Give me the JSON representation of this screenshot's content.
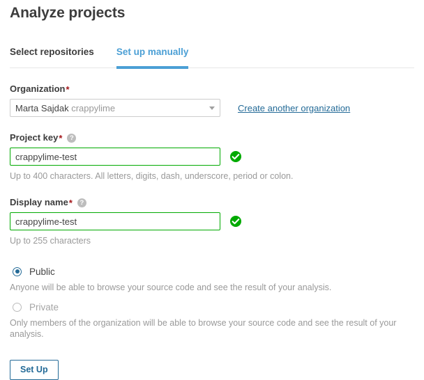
{
  "page": {
    "title": "Analyze projects"
  },
  "tabs": [
    {
      "label": "Select repositories",
      "active": false
    },
    {
      "label": "Set up manually",
      "active": true
    }
  ],
  "organization": {
    "label": "Organization",
    "required_marker": "*",
    "selected_name": "Marta Sajdak",
    "selected_key": "crappylime",
    "dropdown_icon": "chevron-down-icon",
    "create_link": "Create another organization"
  },
  "project_key": {
    "label": "Project key",
    "required_marker": "*",
    "help_icon": "help-icon",
    "value": "crappylime-test",
    "placeholder": "",
    "valid_icon": "check-circle-icon",
    "hint": "Up to 400 characters. All letters, digits, dash, underscore, period or colon."
  },
  "display_name": {
    "label": "Display name",
    "required_marker": "*",
    "help_icon": "help-icon",
    "value": "crappylime-test",
    "placeholder": "",
    "valid_icon": "check-circle-icon",
    "hint": "Up to 255 characters"
  },
  "visibility": {
    "public": {
      "label": "Public",
      "selected": true,
      "description": "Anyone will be able to browse your source code and see the result of your analysis."
    },
    "private": {
      "label": "Private",
      "selected": false,
      "description": "Only members of the organization will be able to browse your source code and see the result of your analysis."
    }
  },
  "actions": {
    "setup_label": "Set Up"
  },
  "colors": {
    "accent_blue": "#4b9fd5",
    "link_blue": "#236a97",
    "valid_green": "#00aa00",
    "required_red": "#a4161a",
    "text_dark": "#3c3c3c",
    "text_muted": "#999999"
  }
}
